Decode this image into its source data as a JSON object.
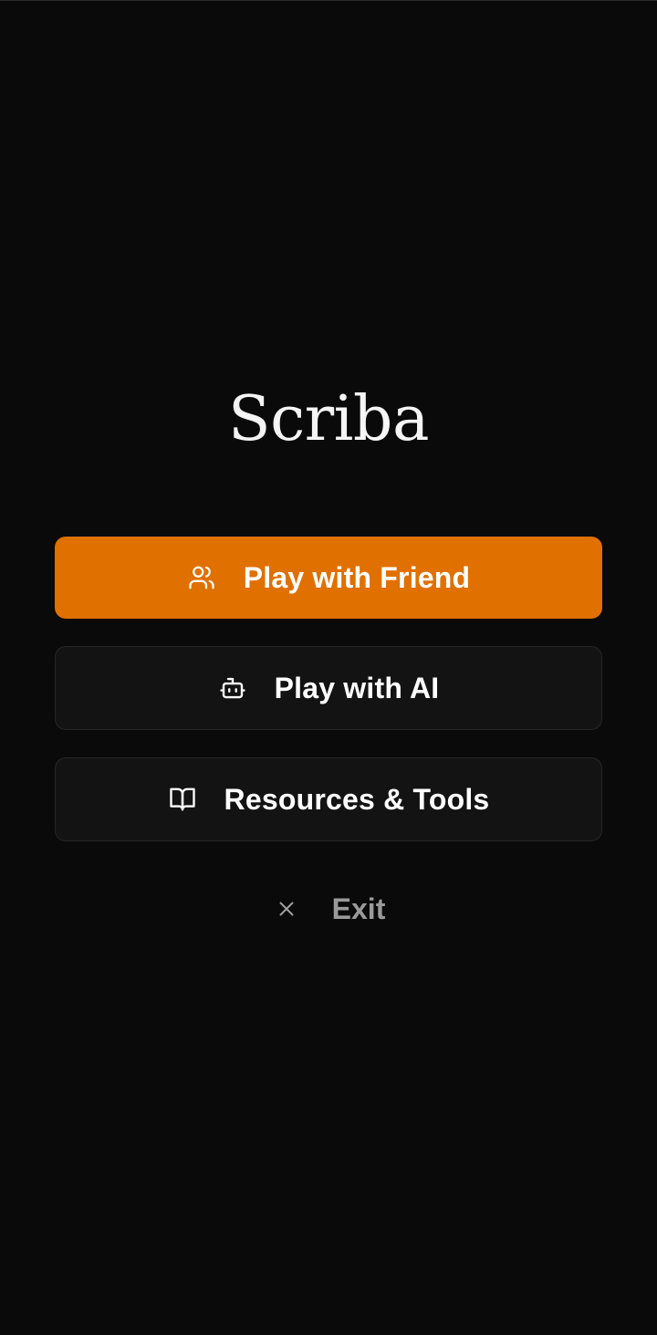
{
  "app": {
    "title": "Scriba"
  },
  "menu": {
    "play_friend": {
      "label": "Play with Friend",
      "icon": "users-icon"
    },
    "play_ai": {
      "label": "Play with AI",
      "icon": "bot-icon"
    },
    "resources": {
      "label": "Resources & Tools",
      "icon": "book-open-icon"
    },
    "exit": {
      "label": "Exit",
      "icon": "close-icon"
    }
  },
  "colors": {
    "background": "#0a0a0a",
    "accent": "#e07000",
    "secondary_button": "#131313",
    "muted_text": "#9a9a9a"
  }
}
